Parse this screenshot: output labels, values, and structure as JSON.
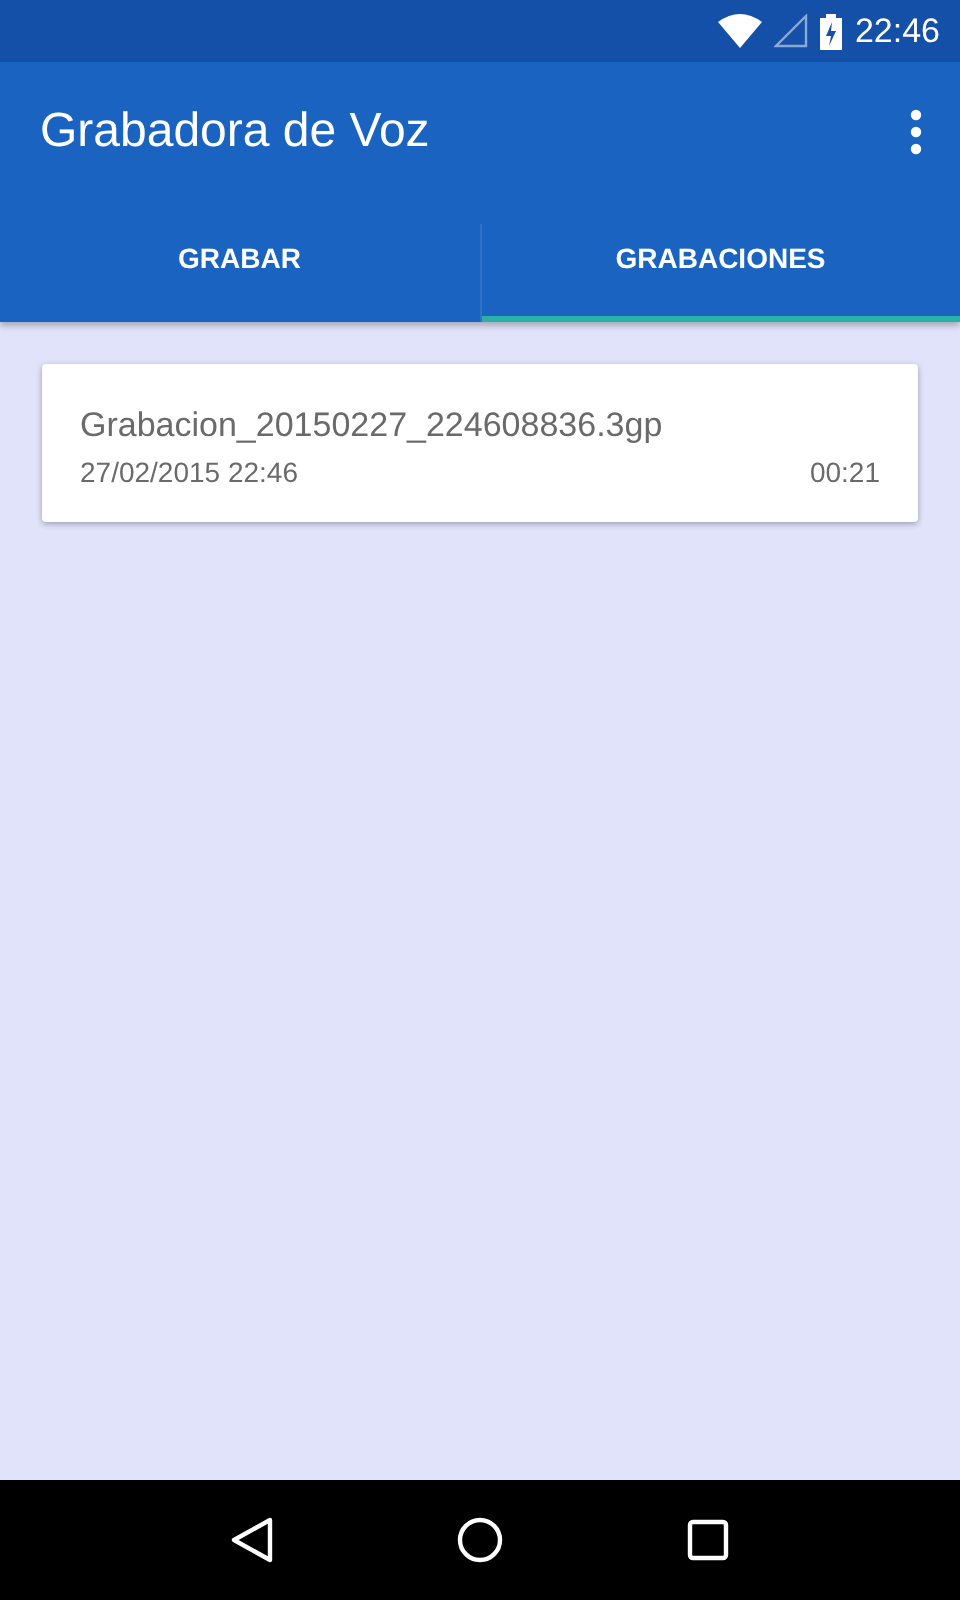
{
  "status_bar": {
    "time": "22:46"
  },
  "app_bar": {
    "title": "Grabadora de Voz"
  },
  "tabs": [
    {
      "label": "GRABAR",
      "selected": false
    },
    {
      "label": "GRABACIONES",
      "selected": true
    }
  ],
  "recordings": [
    {
      "name": "Grabacion_20150227_224608836.3gp",
      "date": "27/02/2015 22:46",
      "duration": "00:21"
    }
  ]
}
